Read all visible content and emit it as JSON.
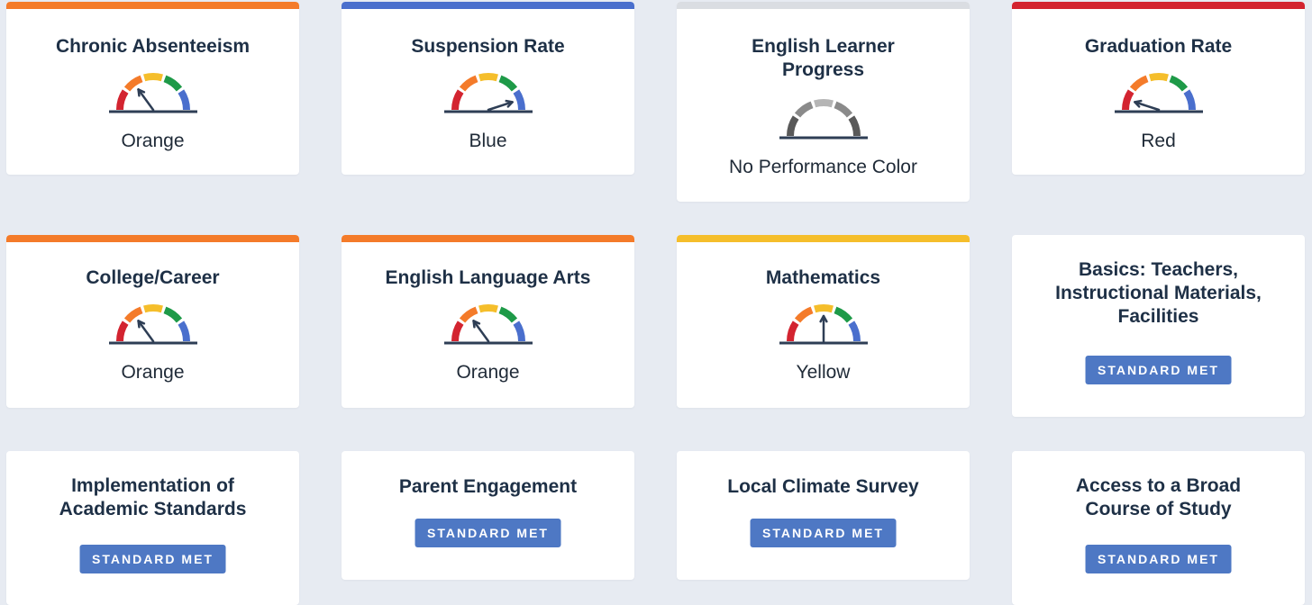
{
  "colors": {
    "red": "#d32430",
    "orange": "#f47b2a",
    "yellow": "#f5be2b",
    "green": "#1e9a48",
    "blue": "#4a6fcd",
    "gray": "#dadde2",
    "needle": "#2e3e55",
    "badge": "#4e78c4"
  },
  "cards": [
    {
      "title": "Chronic Absenteeism",
      "status": "Orange",
      "topbar": "orange",
      "level": 2
    },
    {
      "title": "Suspension Rate",
      "status": "Blue",
      "topbar": "blue",
      "level": 5
    },
    {
      "title": "English Learner Progress",
      "status": "No Performance Color",
      "topbar": "gray",
      "level": 0
    },
    {
      "title": "Graduation Rate",
      "status": "Red",
      "topbar": "red",
      "level": 1
    },
    {
      "title": "College/Career",
      "status": "Orange",
      "topbar": "orange",
      "level": 2
    },
    {
      "title": "English Language Arts",
      "status": "Orange",
      "topbar": "orange",
      "level": 2
    },
    {
      "title": "Mathematics",
      "status": "Yellow",
      "topbar": "yellow",
      "level": 3
    },
    {
      "title": "Basics: Teachers, Instructional Materials, Facilities",
      "badge": "STANDARD MET"
    },
    {
      "title": "Implementation of Academic Standards",
      "badge": "STANDARD MET"
    },
    {
      "title": "Parent Engagement",
      "badge": "STANDARD MET"
    },
    {
      "title": "Local Climate Survey",
      "badge": "STANDARD MET"
    },
    {
      "title": "Access to a Broad Course of Study",
      "badge": "STANDARD MET"
    }
  ]
}
